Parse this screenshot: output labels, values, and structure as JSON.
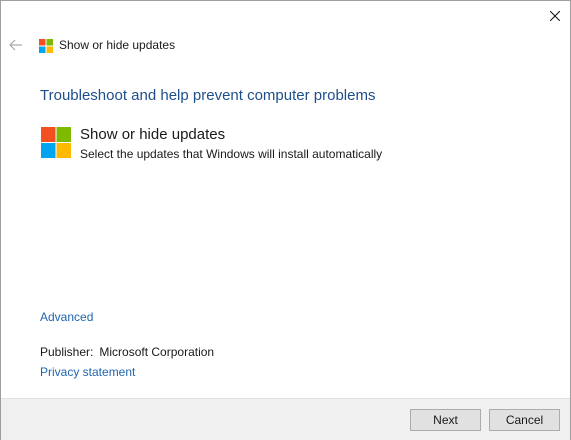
{
  "window": {
    "title": "Show or hide updates"
  },
  "icons": {
    "close": "close-icon",
    "back": "back-arrow-icon",
    "logo": "windows-logo-icon"
  },
  "colors": {
    "logo_red": "#f25022",
    "logo_green": "#7fba00",
    "logo_blue": "#00a4ef",
    "logo_yellow": "#ffb900",
    "heading": "#1e4e8c",
    "link": "#1e66b0"
  },
  "main": {
    "heading": "Troubleshoot and help prevent computer problems",
    "tool_title": "Show or hide updates",
    "tool_description": "Select the updates that Windows will install automatically"
  },
  "links": {
    "advanced": "Advanced",
    "privacy": "Privacy statement"
  },
  "publisher": {
    "label": "Publisher:",
    "value": "Microsoft Corporation"
  },
  "footer": {
    "next_label": "Next",
    "cancel_label": "Cancel"
  }
}
